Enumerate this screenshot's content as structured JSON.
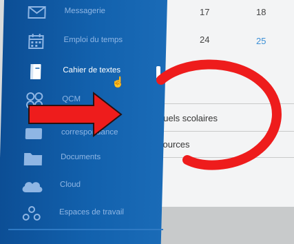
{
  "calendar": {
    "row1": [
      "17",
      "18"
    ],
    "row2": [
      "24",
      "25"
    ]
  },
  "resources": {
    "row1": "nuels scolaires",
    "row2": "sources"
  },
  "sidebar": {
    "items": [
      {
        "label": "Messagerie",
        "icon": "envelope-icon"
      },
      {
        "label": "Emploi du temps",
        "icon": "calendar-icon"
      },
      {
        "label": "Cahier de textes",
        "icon": "notebook-icon",
        "active": true
      },
      {
        "label": "QCM",
        "icon": "qcm-icon"
      },
      {
        "label": "correspondance",
        "icon": "correspondence-icon"
      },
      {
        "label": "Documents",
        "icon": "folder-icon"
      },
      {
        "label": "Cloud",
        "icon": "cloud-icon"
      },
      {
        "label": "Espaces de travail",
        "icon": "workspace-icon"
      }
    ]
  },
  "colors": {
    "sidebar": "#1261ad",
    "annotation": "#ee1c1c",
    "highlight_day": "#3b8fd6"
  }
}
